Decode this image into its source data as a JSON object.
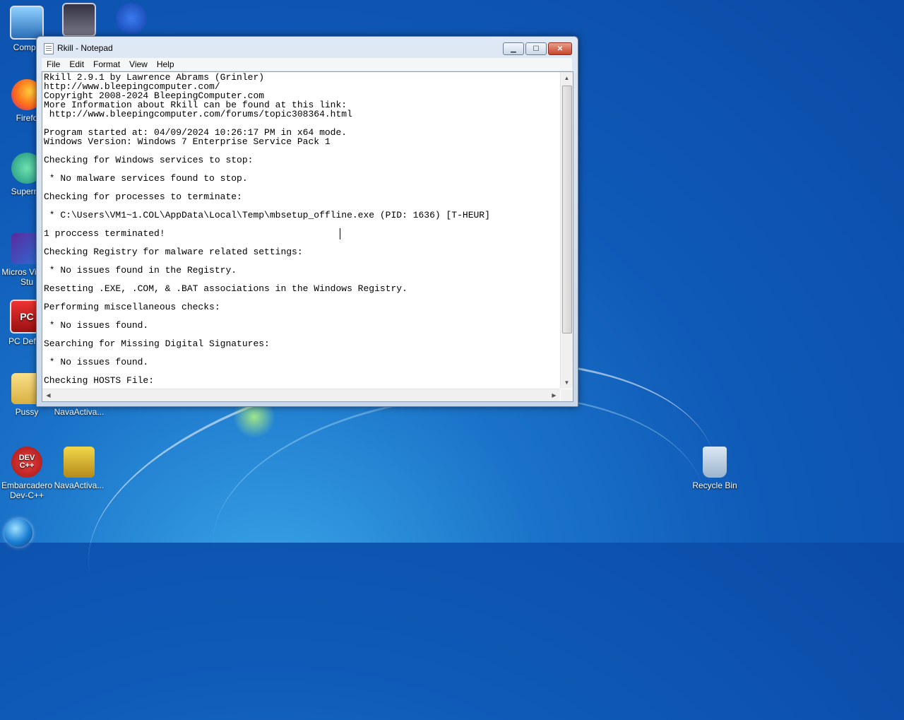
{
  "desktop": {
    "icons": [
      {
        "label": "Compu",
        "img_text": ""
      },
      {
        "label": "",
        "img_text": ""
      },
      {
        "label": "",
        "img_text": ""
      },
      {
        "label": "Firefo",
        "img_text": ""
      },
      {
        "label": "Supermi",
        "img_text": ""
      },
      {
        "label": "Micros Visual Stu",
        "img_text": ""
      },
      {
        "label": "PC Defen",
        "img_text": "PC"
      },
      {
        "label": "Pussy",
        "img_text": ""
      },
      {
        "label": "NavaActiva...",
        "img_text": ""
      },
      {
        "label": "Embarcadero Dev-C++",
        "img_text": "DEV C++"
      },
      {
        "label": "NavaActiva...",
        "img_text": ""
      },
      {
        "label": "Recycle Bin",
        "img_text": ""
      }
    ]
  },
  "window": {
    "title": "Rkill - Notepad",
    "controls": {
      "minimize": "▁",
      "maximize": "☐",
      "close": "✕"
    },
    "menu": [
      "File",
      "Edit",
      "Format",
      "View",
      "Help"
    ]
  },
  "document": {
    "lines": [
      "Rkill 2.9.1 by Lawrence Abrams (Grinler)",
      "http://www.bleepingcomputer.com/",
      "Copyright 2008-2024 BleepingComputer.com",
      "More Information about Rkill can be found at this link:",
      " http://www.bleepingcomputer.com/forums/topic308364.html",
      "",
      "Program started at: 04/09/2024 10:26:17 PM in x64 mode.",
      "Windows Version: Windows 7 Enterprise Service Pack 1",
      "",
      "Checking for Windows services to stop:",
      "",
      " * No malware services found to stop.",
      "",
      "Checking for processes to terminate:",
      "",
      " * C:\\Users\\VM1~1.COL\\AppData\\Local\\Temp\\mbsetup_offline.exe (PID: 1636) [T-HEUR]",
      "",
      "1 proccess terminated!",
      "",
      "Checking Registry for malware related settings:",
      "",
      " * No issues found in the Registry.",
      "",
      "Resetting .EXE, .COM, & .BAT associations in the Windows Registry.",
      "",
      "Performing miscellaneous checks:",
      "",
      " * No issues found.",
      "",
      "Searching for Missing Digital Signatures:",
      "",
      " * No issues found.",
      "",
      "Checking HOSTS File:"
    ]
  },
  "colors": {
    "desktop_bg": "#0f5bb8",
    "close_button": "#c7442a"
  }
}
